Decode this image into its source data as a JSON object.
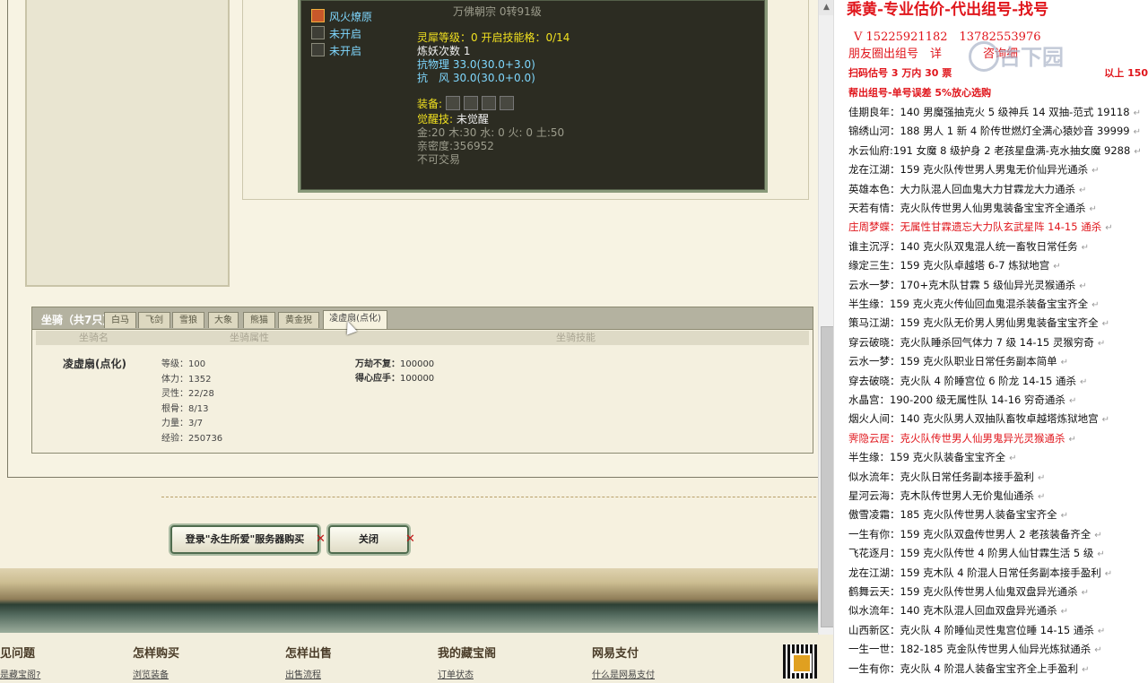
{
  "tooltip": {
    "truncated_top": "万佛朝宗 0转91级",
    "skills": [
      {
        "label": "风火燎原",
        "icon": "fire-skill-icon"
      },
      {
        "label": "未开启",
        "icon": "locked-slot-icon"
      },
      {
        "label": "未开启",
        "icon": "locked-slot-icon"
      }
    ],
    "spirit_level": "灵犀等级：0 开启技能格：0/14",
    "refine_count": "炼妖次数 1",
    "resist_physical": "抗物理 33.0(30.0+3.0)",
    "resist_wind": "抗　风 30.0(30.0+0.0)",
    "equip_label": "装备:",
    "awaken_label": "觉醒技:",
    "awaken_value": "未觉醒",
    "elements": "金:20 木:30 水: 0 火: 0 土:50",
    "intimacy": "亲密度:356952",
    "untradeable": "不可交易"
  },
  "mount": {
    "title": "坐骑（共7只）",
    "tabs": [
      "白马",
      "飞剑",
      "雪狼",
      "大象",
      "熊猫",
      "黄金猊",
      "凌虚扇(点化)"
    ],
    "active_tab": 6,
    "headers": {
      "name": "坐骑名",
      "attrs": "坐骑属性",
      "skills": "坐骑技能"
    },
    "name": "凌虚扇(点化)",
    "attributes": [
      "等级：100",
      "体力：1352",
      "灵性：22/28",
      "根骨：8/13",
      "力量：3/7",
      "经验：250736"
    ],
    "skills": [
      {
        "name": "万劫不复：",
        "value": "100000"
      },
      {
        "name": "得心应手：",
        "value": "100000"
      }
    ]
  },
  "buttons": {
    "login_buy": "登录\"永生所爱\"服务器购买",
    "close": "关闭"
  },
  "footer": {
    "sections": [
      {
        "title": "见问题",
        "link": "是藏宝阁?"
      },
      {
        "title": "怎样购买",
        "link": "浏览装备"
      },
      {
        "title": "怎样出售",
        "link": "出售流程"
      },
      {
        "title": "我的藏宝阁",
        "link": "订单状态"
      },
      {
        "title": "网易支付",
        "link": "什么是网易支付"
      }
    ]
  },
  "sidebar": {
    "header": "乘黄-专业估价-代出组号-找号",
    "phones": "V 15225921182　13782553976",
    "moments": "朋友圈出组号　详",
    "moments_tail": "咨询细",
    "promo1": "扫码估号 3 万内 30 票",
    "promo1_tail": "以上 150",
    "promo2": "帮出组号-单号误差 5%放心选购",
    "watermark": "古下园",
    "lines": [
      {
        "text": "佳期良年：140 男魔强抽克火 5 级神兵 14 双抽-范式 19118",
        "red": false
      },
      {
        "text": "锦绣山河：188 男人 1 新 4 阶传世燃灯全满心猿妙音 39999",
        "red": false
      },
      {
        "text": "水云仙府:191 女魔 8 级护身 2 老孩星盘满-克水抽女魔 9288",
        "red": false
      },
      {
        "text": "龙在江湖：159 克火队传世男人男鬼无价仙异光通杀",
        "red": false
      },
      {
        "text": "英雄本色：大力队混人回血鬼大力甘霖龙大力通杀",
        "red": false
      },
      {
        "text": "天若有情：克火队传世男人仙男鬼装备宝宝齐全通杀",
        "red": false
      },
      {
        "text": "庄周梦蝶：无属性甘霖遗忘大力队玄武星阵 14-15 通杀",
        "red": true
      },
      {
        "text": "谁主沉浮：140 克火队双鬼混人统一畜牧日常任务",
        "red": false
      },
      {
        "text": "缘定三生：159 克火队卓越塔 6-7 炼狱地宫",
        "red": false
      },
      {
        "text": "云水一梦：170+克木队甘霖 5 级仙异光灵猴通杀",
        "red": false
      },
      {
        "text": "半生缘：159 克火克火传仙回血鬼混杀装备宝宝齐全",
        "red": false
      },
      {
        "text": "策马江湖：159 克火队无价男人男仙男鬼装备宝宝齐全",
        "red": false
      },
      {
        "text": "穿云破晓：克火队睡杀回气体力 7 级 14-15 灵猴穷奇",
        "red": false
      },
      {
        "text": "云水一梦：159 克火队职业日常任务副本简单",
        "red": false
      },
      {
        "text": "穿去破晓：克火队 4 阶睡宫位 6 阶龙 14-15 通杀",
        "red": false
      },
      {
        "text": "水晶宫：190-200 级无属性队 14-16 穷奇通杀",
        "red": false
      },
      {
        "text": "烟火人间：140 克火队男人双抽队畜牧卓越塔炼狱地宫",
        "red": false
      },
      {
        "text": "霁隐云居：克火队传世男人仙男鬼异光灵猴通杀",
        "red": true
      },
      {
        "text": "半生缘：159 克火队装备宝宝齐全",
        "red": false
      },
      {
        "text": "似水流年：克火队日常任务副本接手盈利",
        "red": false
      },
      {
        "text": "星河云海：克木队传世男人无价鬼仙通杀",
        "red": false
      },
      {
        "text": "傲雪凌霜：185 克火队传世男人装备宝宝齐全",
        "red": false
      },
      {
        "text": "一生有你：159 克火队双盘传世男人 2 老孩装备齐全",
        "red": false
      },
      {
        "text": "飞花逐月：159 克火队传世 4 阶男人仙甘霖生活 5 级",
        "red": false
      },
      {
        "text": "龙在江湖：159 克木队 4 阶混人日常任务副本接手盈利",
        "red": false
      },
      {
        "text": "鹤舞云天：159 克火队传世男人仙鬼双盘异光通杀",
        "red": false
      },
      {
        "text": "似水流年：140 克木队混人回血双盘异光通杀",
        "red": false
      },
      {
        "text": "山西新区：克火队 4 阶睡仙灵性鬼宫位睡 14-15 通杀",
        "red": false
      },
      {
        "text": "一生一世：182-185 克金队传世男人仙异光炼狱通杀",
        "red": false
      },
      {
        "text": "一生有你：克火队 4 阶混人装备宝宝齐全上手盈利",
        "red": false
      }
    ]
  }
}
